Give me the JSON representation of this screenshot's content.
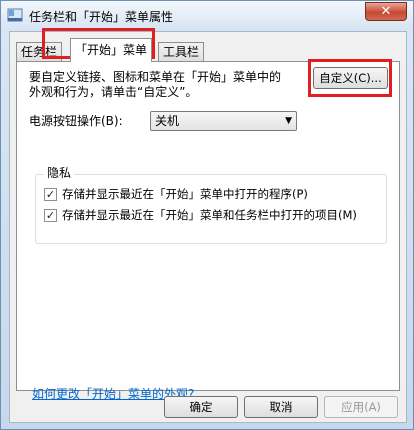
{
  "window": {
    "title": "任务栏和「开始」菜单属性",
    "close_label": "✕"
  },
  "tabs": [
    {
      "label": "任务栏",
      "active": false
    },
    {
      "label": "「开始」菜单",
      "active": true
    },
    {
      "label": "工具栏",
      "active": false
    }
  ],
  "start_menu": {
    "description_line1": "要自定义链接、图标和菜单在「开始」菜单中的",
    "description_line2": "外观和行为，请单击“自定义”。",
    "customize_button": "自定义(C)...",
    "power_label": "电源按钮操作(B):",
    "power_value": "关机"
  },
  "privacy": {
    "title": "隐私",
    "items": [
      {
        "label": "存储并显示最近在「开始」菜单中打开的程序(P)",
        "checked": true
      },
      {
        "label": "存储并显示最近在「开始」菜单和任务栏中打开的项目(M)",
        "checked": true
      }
    ]
  },
  "help_link": "如何更改「开始」菜单的外观?",
  "buttons": {
    "ok": "确定",
    "cancel": "取消",
    "apply": "应用(A)"
  },
  "colors": {
    "highlight_box": "#e02020",
    "link": "#0066cc"
  }
}
